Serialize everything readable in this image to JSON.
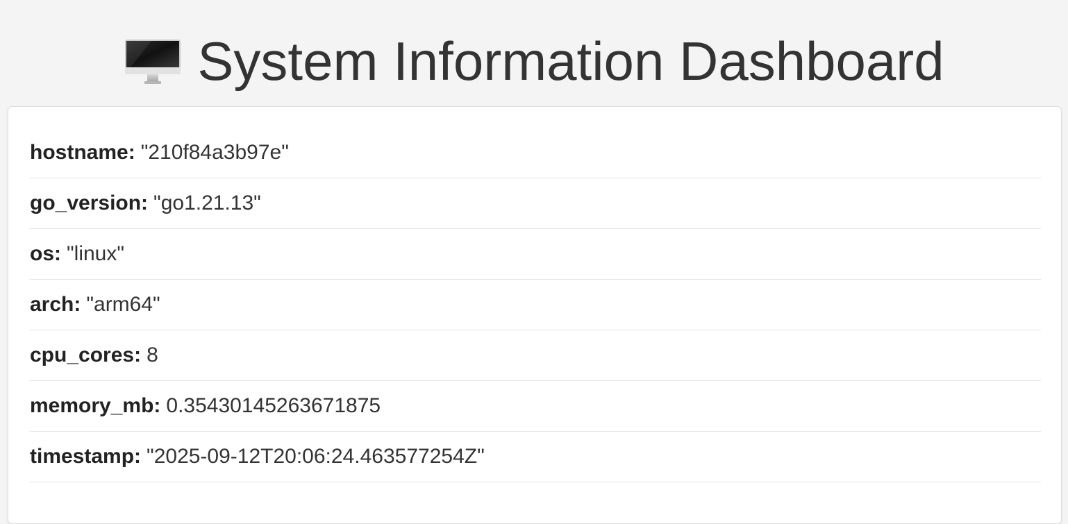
{
  "header": {
    "icon": "desktop-computer-icon",
    "title": "System Information Dashboard"
  },
  "info": {
    "rows": [
      {
        "key": "hostname:",
        "value": "\"210f84a3b97e\""
      },
      {
        "key": "go_version:",
        "value": "\"go1.21.13\""
      },
      {
        "key": "os:",
        "value": "\"linux\""
      },
      {
        "key": "arch:",
        "value": "\"arm64\""
      },
      {
        "key": "cpu_cores:",
        "value": "8"
      },
      {
        "key": "memory_mb:",
        "value": "0.35430145263671875"
      },
      {
        "key": "timestamp:",
        "value": "\"2025-09-12T20:06:24.463577254Z\""
      }
    ]
  },
  "colors": {
    "background": "#f4f4f4",
    "card": "#ffffff",
    "text": "#333333",
    "divider": "#e3e3e3"
  }
}
